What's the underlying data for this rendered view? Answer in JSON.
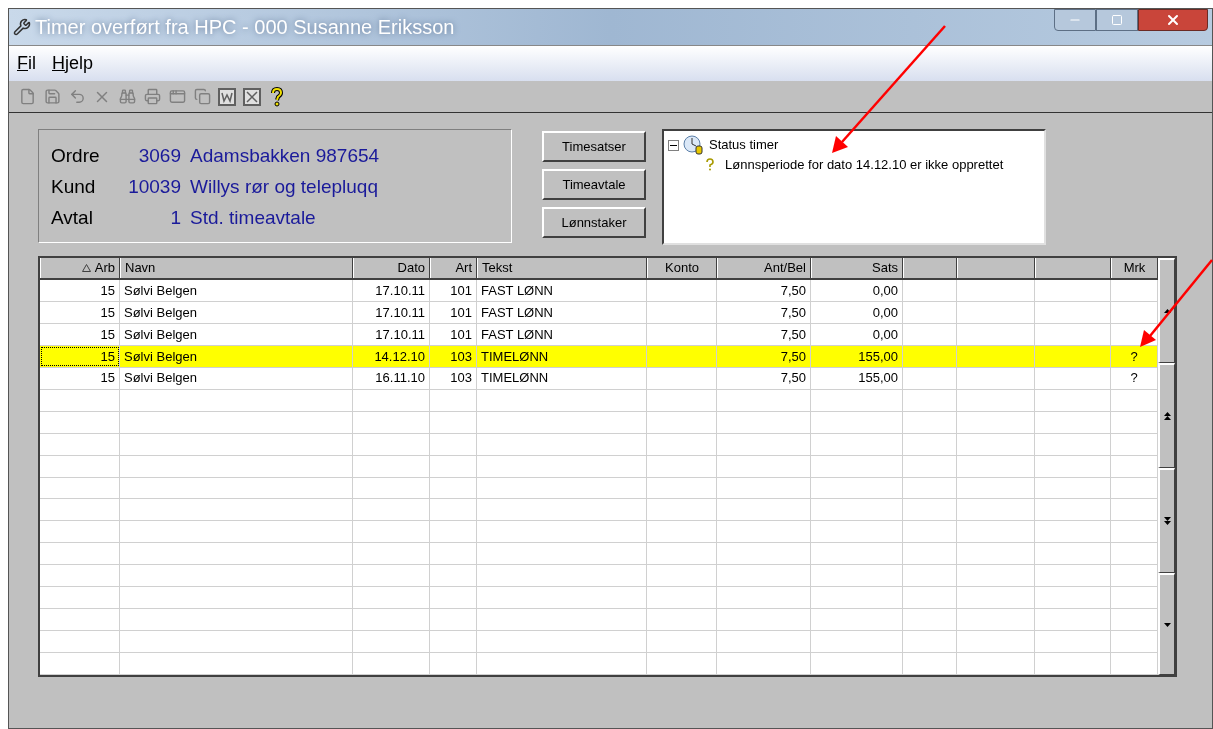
{
  "window": {
    "title": "Timer overført fra HPC - 000 Susanne Eriksson"
  },
  "menu": [
    {
      "label": "Fil"
    },
    {
      "label": "Hjelp"
    }
  ],
  "info": [
    {
      "label": "Ordre",
      "number": "3069",
      "text": "Adamsbakken 987654"
    },
    {
      "label": "Kund",
      "number": "10039",
      "text": "Willys rør og telepluqq"
    },
    {
      "label": "Avtal",
      "number": "1",
      "text": "Std. timeavtale"
    }
  ],
  "buttons": [
    "Timesatser",
    "Timeavtale",
    "Lønnstaker"
  ],
  "status_tree": {
    "label": "Status timer",
    "expanded": true,
    "children": [
      {
        "label": "Lønnsperiode for dato 14.12.10 er ikke opprettet"
      }
    ]
  },
  "table": {
    "columns": [
      {
        "label": "Arb",
        "sorted": true
      },
      {
        "label": "Navn",
        "sorted": false
      },
      {
        "label": "Dato",
        "sorted": false
      },
      {
        "label": "Art",
        "sorted": false
      },
      {
        "label": "Tekst",
        "sorted": false
      },
      {
        "label": "Konto",
        "sorted": false
      },
      {
        "label": "Ant/Bel",
        "sorted": false
      },
      {
        "label": "Sats",
        "sorted": false
      },
      {
        "sorted": false
      },
      {
        "sorted": false
      },
      {
        "sorted": false
      },
      {
        "label": "Mrk",
        "sorted": false
      }
    ],
    "rows": [
      {
        "selected": false,
        "arb": "15",
        "navn": "Sølvi Belgen",
        "dato": "17.10.11",
        "art": "101",
        "tekst": "FAST LØNN",
        "ant_bel": "7,50",
        "sats": "0,00"
      },
      {
        "selected": false,
        "arb": "15",
        "navn": "Sølvi Belgen",
        "dato": "17.10.11",
        "art": "101",
        "tekst": "FAST LØNN",
        "ant_bel": "7,50",
        "sats": "0,00"
      },
      {
        "selected": false,
        "arb": "15",
        "navn": "Sølvi Belgen",
        "dato": "17.10.11",
        "art": "101",
        "tekst": "FAST LØNN",
        "ant_bel": "7,50",
        "sats": "0,00"
      },
      {
        "selected": true,
        "arb": "15",
        "navn": "Sølvi Belgen",
        "dato": "14.12.10",
        "art": "103",
        "tekst": "TIMELØNN",
        "ant_bel": "7,50",
        "sats": "155,00",
        "mrk": "?"
      },
      {
        "selected": false,
        "arb": "15",
        "navn": "Sølvi Belgen",
        "dato": "16.11.10",
        "art": "103",
        "tekst": "TIMELØNN",
        "ant_bel": "7,50",
        "sats": "155,00",
        "mrk": "?"
      }
    ]
  }
}
